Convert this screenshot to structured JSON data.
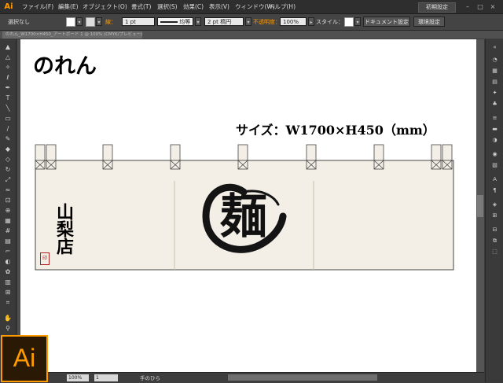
{
  "app": {
    "logo": "Ai"
  },
  "menu": {
    "items": [
      "ファイル(F)",
      "編集(E)",
      "オブジェクト(O)",
      "書式(T)",
      "選択(S)",
      "効果(C)",
      "表示(V)",
      "ウィンドウ(W)",
      "ヘルプ(H)"
    ],
    "workspace": "初期設定",
    "window_controls": [
      "–",
      "□",
      "×"
    ]
  },
  "control": {
    "selection_label": "選択なし",
    "stroke_label": "線：",
    "stroke_weight": "1 pt",
    "uniform_label": "均等",
    "brush_label": "2 pt 楕円",
    "opacity_label": "不透明度：",
    "opacity_value": "100%",
    "style_label": "スタイル：",
    "doc_settings": "ドキュメント設定",
    "preferences": "環境設定"
  },
  "document": {
    "tab_title": "のれん_W1700×H450_アートボード 1 @ 100% (CMYK/プレビュー)"
  },
  "toolbar": {
    "icons": [
      "selection-icon",
      "direct-selection-icon",
      "magic-wand-icon",
      "lasso-icon",
      "pen-icon",
      "type-icon",
      "line-icon",
      "rectangle-icon",
      "paintbrush-icon",
      "pencil-icon",
      "blob-brush-icon",
      "eraser-icon",
      "rotate-icon",
      "scale-icon",
      "width-icon",
      "free-transform-icon",
      "shape-builder-icon",
      "perspective-icon",
      "mesh-icon",
      "gradient-icon",
      "eyedropper-icon",
      "blend-icon",
      "symbol-sprayer-icon",
      "graph-icon",
      "artboard-icon",
      "slice-icon",
      "hand-icon",
      "zoom-icon"
    ]
  },
  "status": {
    "zoom": "100%",
    "page": "1",
    "current_tool": "手のひら"
  },
  "artwork": {
    "title": "のれん",
    "size_label": "サイズ：W1700×H450（mm）",
    "shop_name": "山梨店",
    "logo_char": "麺",
    "seal_char": "印"
  },
  "colors": {
    "accent": "#ff9a00",
    "cloth": "#f4efe6",
    "ink": "#111111"
  }
}
